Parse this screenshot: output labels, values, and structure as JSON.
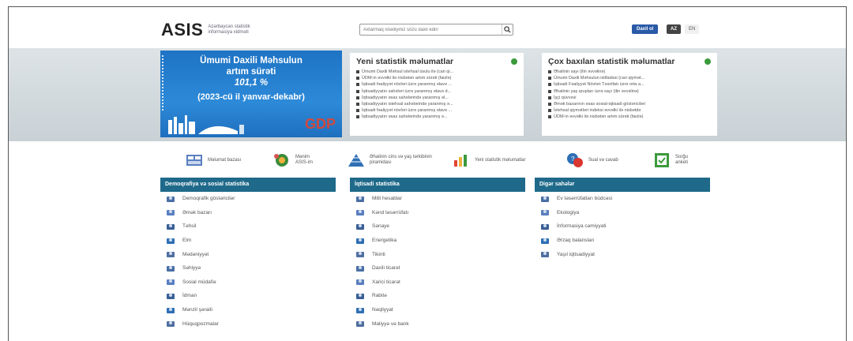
{
  "header": {
    "logo": "ASIS",
    "logo_subtitle": "Azərbaycan statistik informasiya xidməti",
    "search_placeholder": "Axtarmaq istədiyiniz sözü daxil edin",
    "login_label": "Daxil ol",
    "lang_az": "AZ",
    "lang_en": "EN"
  },
  "banner": {
    "gdp_title_line1": "Ümumi Daxili Məhsulun",
    "gdp_title_line2": "artım sürəti",
    "gdp_value": "101,1 %",
    "gdp_period": "(2023-cü il yanvar-dekabr)",
    "gdp_word": "GDP"
  },
  "news_new": {
    "title": "Yeni statistik məlumatlar",
    "items": [
      "Ümumi Daxili Məhsul istehsal üsulu ilə (cari qi...",
      "ÜDM-in əvvəlki ilə nisbətən artım sürəti (faizlə)",
      "İqtisadi fəaliyyət növləri üzrə yaranmış əlavə ...",
      "İqtisadiyyatın sahələri üzrə yaranmış əlavə d...",
      "İqtisadiyyatın əsas sahələrində yaranmış əl...",
      "İqtisadiyyatın istehsal sahələrində yaranmış ə...",
      "İqtisadi fəaliyyət növləri üzrə yaranmış əlavə ...",
      "İqtisadiyyatın əsas sahələrində yaranmış ə..."
    ]
  },
  "news_popular": {
    "title": "Çox baxılan statistik məlumatlar",
    "items": [
      "Əhalinin sayı (ilin əvvəlinə)",
      "Ümumi Daxili Məhsulun istifadəsi (cari qiymət...",
      "İqtisadi Fəaliyyət Növləri Təsnifatı üzrə orta a...",
      "Əhalinin yaş qrupları üzrə sayı (ilin əvvəlinə)",
      "İşçi qüvvəsi",
      "Əmək bazarının əsas sosial-iqtisadi göstəriciləri",
      "İstehsal qiymətləri indeksi əvvəlki ilə nisbətdə",
      "ÜDM-in əvvəlki ilə nisbətən artım sürəti (faizlə)"
    ]
  },
  "quick_links": [
    {
      "label": "Məlumat bazası",
      "icon": "database-icon"
    },
    {
      "label": "Mənim ASIS-im",
      "icon": "my-asis-icon"
    },
    {
      "label": "Əhalinin cins və yaş tərkibinin piramidası",
      "icon": "pyramid-icon"
    },
    {
      "label": "Yeni statistik məlumatlar",
      "icon": "new-data-icon"
    },
    {
      "label": "Sual və cavab",
      "icon": "qa-icon"
    },
    {
      "label": "Sorğu anketi",
      "icon": "survey-icon"
    }
  ],
  "categories": {
    "demographic": {
      "title": "Demoqrafiya və sosial statistika",
      "items": [
        "Demoqrafik göstəricilər",
        "Əmək bazarı",
        "Təhsil",
        "Elm",
        "Mədəniyyət",
        "Səhiyyə",
        "Sosial müdafiə",
        "İdman",
        "Mənzil şəraiti",
        "Hüquqpozmalar"
      ]
    },
    "economic": {
      "title": "İqtisadi statistika",
      "items": [
        "Milli hesablar",
        "Kənd təsərrüfatı",
        "Sənaye",
        "Energetika",
        "Tikinti",
        "Daxili ticarət",
        "Xarici ticarət",
        "Rabitə",
        "Nəqliyyat",
        "Maliyyə və bank"
      ]
    },
    "other": {
      "title": "Digər sahələr",
      "items": [
        "Ev təsərrüfatları büdcəsi",
        "Ekologiya",
        "İnformasiya cəmiyyəti",
        "Ərzaq balansları",
        "Yaşıl iqtisadiyyat"
      ]
    }
  },
  "colors": {
    "accent_blue": "#1f6a8a",
    "login_blue": "#2a5aa8",
    "gdp_red": "#e2452f",
    "status_green": "#3c9a3c"
  }
}
